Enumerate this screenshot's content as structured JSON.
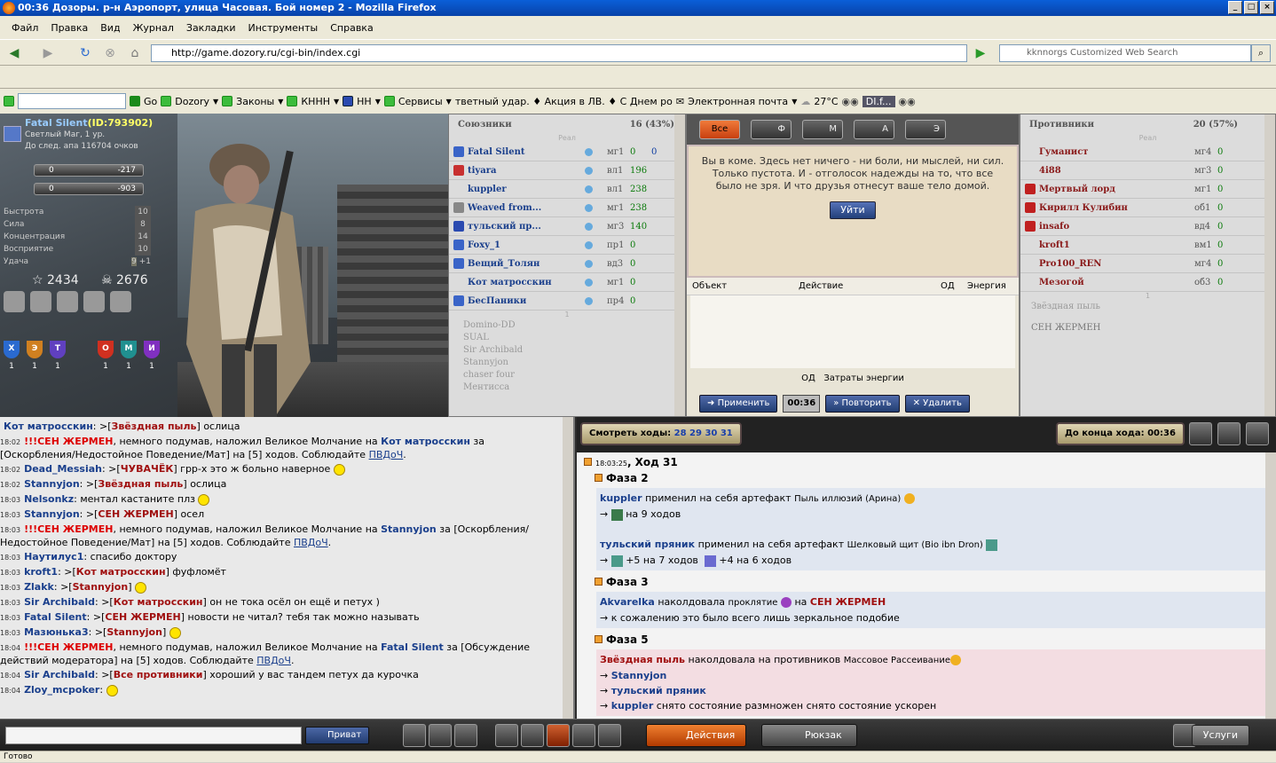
{
  "window": {
    "title": "00:36 Дозоры. р-н Аэропорт, улица Часовая. Бой номер 2 - Mozilla Firefox"
  },
  "menu": [
    "Файл",
    "Правка",
    "Вид",
    "Журнал",
    "Закладки",
    "Инструменты",
    "Справка"
  ],
  "nav": {
    "url": "http://game.dozory.ru/cgi-bin/index.cgi",
    "search_placeholder": "kknnorgs Customized Web Search"
  },
  "toolbar2": {
    "go": "Go",
    "items": [
      "Dozory",
      "Законы",
      "КННН",
      "НН",
      "Сервисы"
    ],
    "ticker": "тветный удар. ♦ Акция в ЛВ. ♦ С Днем ро",
    "mail": "Электронная почта",
    "weather": "27°C",
    "player": "DI.f..."
  },
  "character": {
    "name": "Fatal Silent",
    "id": "(ID:793902)",
    "class": "Светлый Маг, 1 ур.",
    "next": "До след. апа 116704 очков",
    "hp": {
      "cur": "0",
      "max": "-217"
    },
    "mp": {
      "cur": "0",
      "max": "-903"
    },
    "stats": [
      {
        "label": "Быстрота",
        "value": "10"
      },
      {
        "label": "Сила",
        "value": "8"
      },
      {
        "label": "Концентрация",
        "value": "14"
      },
      {
        "label": "Восприятие",
        "value": "10"
      },
      {
        "label": "Удача",
        "value": "9",
        "bonus": "+1"
      }
    ],
    "stars": "2434",
    "kills": "2676",
    "shields": [
      {
        "letter": "Х",
        "count": "1",
        "color": "#2a6ad0"
      },
      {
        "letter": "Э",
        "count": "1",
        "color": "#d08020"
      },
      {
        "letter": "Т",
        "count": "1",
        "color": "#6040c0"
      },
      {
        "letter": "О",
        "count": "1",
        "color": "#d03020"
      },
      {
        "letter": "М",
        "count": "1",
        "color": "#209090"
      },
      {
        "letter": "И",
        "count": "1",
        "color": "#8030c0"
      }
    ]
  },
  "allies": {
    "title": "Союзники",
    "count": "16 (43%)",
    "sep": "Реал",
    "rows": [
      {
        "name": "Fatal Silent",
        "level": "мг1",
        "v1": "0",
        "v2": "0",
        "color": "#3a64c8"
      },
      {
        "name": "tiyara",
        "level": "вл1",
        "v1": "196",
        "v2": "",
        "color": "#c83030"
      },
      {
        "name": "kuppler",
        "level": "вл1",
        "v1": "238",
        "v2": "",
        "color": "#dcdcdc"
      },
      {
        "name": "Weaved from...",
        "level": "мг1",
        "v1": "238",
        "v2": "",
        "color": "#888"
      },
      {
        "name": "тульский пр...",
        "level": "мг3",
        "v1": "140",
        "v2": "",
        "color": "#2a4ab0"
      },
      {
        "name": "Foxy_1",
        "level": "пр1",
        "v1": "0",
        "v2": "",
        "color": "#3a64c8"
      },
      {
        "name": "Вещий_Толян",
        "level": "вд3",
        "v1": "0",
        "v2": "",
        "color": "#3a64c8"
      },
      {
        "name": "Кот матросскин",
        "level": "мг1",
        "v1": "0",
        "v2": "",
        "color": "#dcdcdc"
      },
      {
        "name": "БесПаники",
        "level": "пр4",
        "v1": "0",
        "v2": "",
        "color": "#3a64c8"
      }
    ],
    "sep2": "1",
    "faint": [
      "Domino-DD",
      "SUAL",
      "Sir Archibald",
      "Stannyjon",
      "chaser four",
      "Ментисса"
    ]
  },
  "action": {
    "tabs": [
      "Все",
      "Ф",
      "М",
      "А",
      "Э"
    ],
    "coma": "Вы в коме. Здесь нет ничего - ни боли, ни мыслей, ни сил. Только пустота. И - отголосок надежды на то, что все было не зря. И что друзья отнесут ваше тело домой.",
    "leave": "Уйти",
    "cols": [
      "Объект",
      "Действие",
      "ОД",
      "Энергия"
    ],
    "footer": "ОД",
    "footer2": "Затраты энергии",
    "apply": "Применить",
    "timer": "00:36",
    "repeat": "Повторить",
    "delete": "Удалить"
  },
  "enemies": {
    "title": "Противники",
    "count": "20 (57%)",
    "sep": "Реал",
    "rows": [
      {
        "name": "Гуманист",
        "level": "мг4",
        "v1": "0",
        "color": "#dcdcdc"
      },
      {
        "name": "4i88",
        "level": "мг3",
        "v1": "0",
        "color": "#dcdcdc"
      },
      {
        "name": "Мертвый лорд",
        "level": "мг1",
        "v1": "0",
        "color": "#c02020"
      },
      {
        "name": "Кирилл Кулибин",
        "level": "об1",
        "v1": "0",
        "color": "#c02020"
      },
      {
        "name": "insafo",
        "level": "вд4",
        "v1": "0",
        "color": "#c02020"
      },
      {
        "name": "kroft1",
        "level": "вм1",
        "v1": "0",
        "color": "#dcdcdc"
      },
      {
        "name": "Pro100_REN",
        "level": "мг4",
        "v1": "0",
        "color": "#dcdcdc"
      },
      {
        "name": "Мезогой",
        "level": "об3",
        "v1": "0",
        "color": "#dcdcdc"
      }
    ],
    "sep2": "1",
    "faint": [
      "Звёздная пыль"
    ],
    "faint2": "СЕН ЖЕРМЕН"
  },
  "chat": [
    {
      "t": "",
      "u": "Кот матросскин",
      "to": "Звёздная пыль",
      "msg": "ослица"
    },
    {
      "t": "18:02",
      "sys": "!!!СЕН ЖЕРМЕН",
      "msg": ", немного подумав, наложил Великое Молчание на ",
      "tgt": "Кот матросскин",
      "tail": " за [Оскорбления/Недостойное Поведение/Мат] на [5] ходов. Соблюдайте ",
      "lnk": "ПВДоЧ",
      "end": "."
    },
    {
      "t": "18:02",
      "u": "Dead_Messiah",
      "to": "ЧУВАЧЁК",
      "msg": "грр-х это ж больно наверное"
    },
    {
      "t": "18:02",
      "u": "Stannyjon",
      "to": "Звёздная пыль",
      "msg": "ослица"
    },
    {
      "t": "18:03",
      "u": "Nelsonkz",
      "to": "",
      "msg": "ментал кастаните плз"
    },
    {
      "t": "18:03",
      "u": "Stannyjon",
      "to": "СЕН ЖЕРМЕН",
      "msg": "осел"
    },
    {
      "t": "18:03",
      "sys": "!!!СЕН ЖЕРМЕН",
      "msg": ", немного подумав, наложил Великое Молчание на ",
      "tgt": "Stannyjon",
      "tail": " за [Оскорбления/Недостойное Поведение/Мат] на [5] ходов. Соблюдайте ",
      "lnk": "ПВДоЧ",
      "end": "."
    },
    {
      "t": "18:03",
      "u": "Наутилус1",
      "to": "",
      "msg": "спасибо доктору"
    },
    {
      "t": "18:03",
      "u": "kroft1",
      "to": "Кот матросскин",
      "msg": "фуфломёт"
    },
    {
      "t": "18:03",
      "u": "Zlakk",
      "to": "Stannyjon",
      "msg": ""
    },
    {
      "t": "18:03",
      "u": "Sir Archibald",
      "to": "Кот матросскин",
      "msg": "он не тока осёл он ещё и петух )"
    },
    {
      "t": "18:03",
      "u": "Fatal Silent",
      "to": "СЕН ЖЕРМЕН",
      "msg": "новости не читал? тебя так можно называть"
    },
    {
      "t": "18:03",
      "u": "Мазюнька3",
      "to": "Stannyjon",
      "msg": ""
    },
    {
      "t": "18:04",
      "sys": "!!!СЕН ЖЕРМЕН",
      "msg": ", немного подумав, наложил Великое Молчание на ",
      "tgt": "Fatal Silent",
      "tail": " за [Обсуждение действий модератора] на [5] ходов. Соблюдайте ",
      "lnk": "ПВДоЧ",
      "end": "."
    },
    {
      "t": "18:04",
      "u": "Sir Archibald",
      "to": "Все противники",
      "msg": "хороший у вас тандем петух да курочка"
    },
    {
      "t": "18:04",
      "u": "Zloy_mcpoker",
      "to": "",
      "msg": ""
    }
  ],
  "log": {
    "watch_label": "Смотреть ходы:",
    "turns": "28 29 30 31",
    "end_label": "До конца хода: 00:36",
    "time": "18:03:25",
    "turn": ", Ход 31",
    "phase2": "Фаза 2",
    "p2a_user": "kuppler",
    "p2a_text": "применил на себя артефакт",
    "p2a_art": "Пыль иллюзий (Арина)",
    "p2a_eff": "на 9 ходов",
    "p2b_user": "тульский пряник",
    "p2b_text": "применил на себя артефакт",
    "p2b_art": "Шелковый щит (Bio ibn Dron)",
    "p2b_eff1": "+5 на 7 ходов",
    "p2b_eff2": "+4 на 6 ходов",
    "phase3": "Фаза 3",
    "p3_user": "Akvarelka",
    "p3_text": "наколдовала",
    "p3_spell": "проклятие",
    "p3_on": "на",
    "p3_tgt": "СЕН ЖЕРМЕН",
    "p3_res": "к сожалению это было всего лишь зеркальное подобие",
    "phase5": "Фаза 5",
    "p5_user": "Звёздная пыль",
    "p5_text": "наколдовала на противников",
    "p5_spell": "Массовое Рассеивание",
    "p5_t1": "Stannyjon",
    "p5_t2": "тульский пряник",
    "p5_t3": "kuppler",
    "p5_t3txt": "снято состояние размножен снято состояние ускорен"
  },
  "bottom": {
    "privat": "Приват",
    "actions": "Действия",
    "backpack": "Рюкзак",
    "services": "Услуги"
  },
  "status": "Готово"
}
